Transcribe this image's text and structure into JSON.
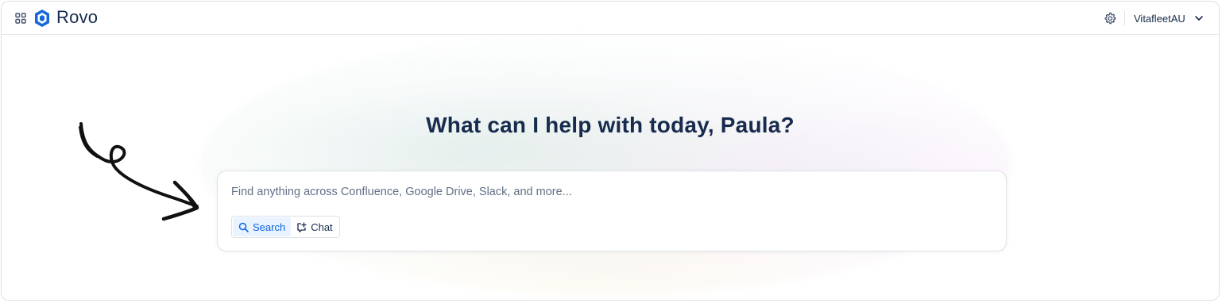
{
  "header": {
    "brand_name": "Rovo",
    "workspace_name": "VitafleetAU"
  },
  "main": {
    "headline": "What can I help with today, Paula?",
    "search": {
      "placeholder": "Find anything across Confluence, Google Drive, Slack, and more..."
    },
    "modes": [
      {
        "label": "Search",
        "active": true
      },
      {
        "label": "Chat",
        "active": false
      }
    ]
  },
  "icons": {
    "app_switcher": "grid-icon",
    "logo": "rovo-logo-icon",
    "settings": "gear-icon",
    "workspace_dropdown": "chevron-down-icon",
    "search_mode": "search-icon",
    "chat_mode": "chat-icon"
  },
  "colors": {
    "accent": "#0c66e4",
    "accent_bg": "#e9f2ff",
    "text": "#172b4d",
    "logo_blue": "#1868db"
  }
}
